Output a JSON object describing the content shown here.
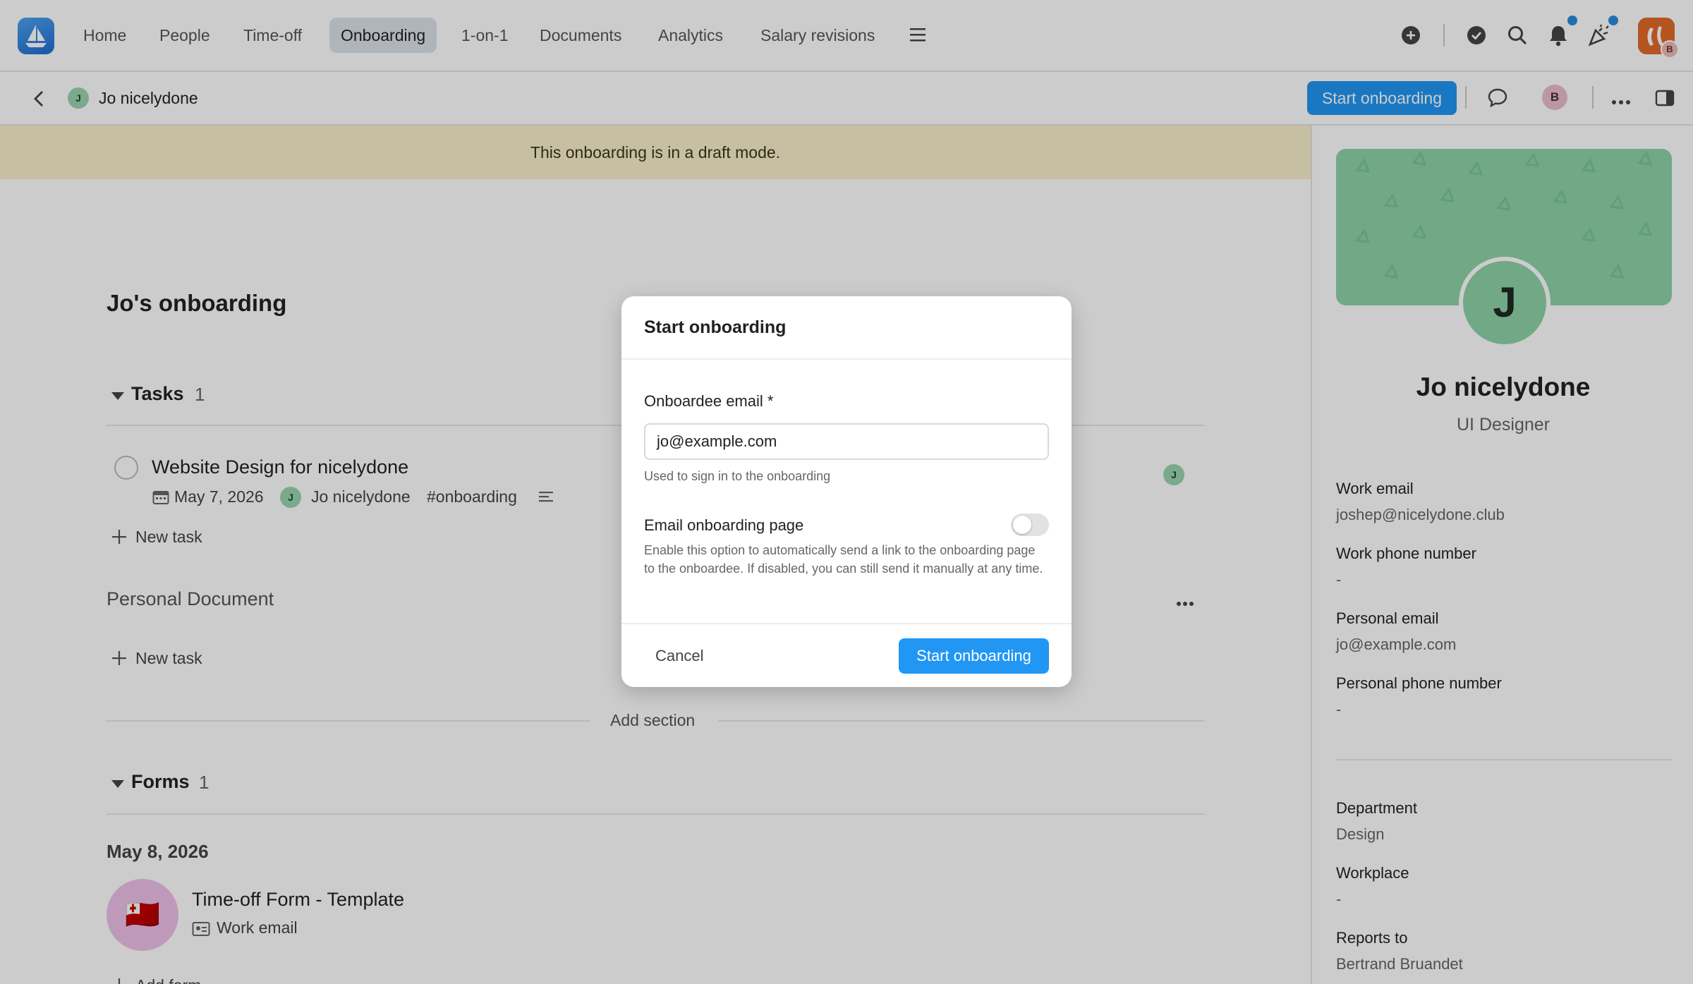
{
  "nav": {
    "items": [
      "Home",
      "People",
      "Time-off",
      "Onboarding",
      "1-on-1",
      "Documents",
      "Analytics",
      "Salary revisions"
    ],
    "active": "Onboarding",
    "brand_initial": "B"
  },
  "subheader": {
    "avatar_initial": "J",
    "name": "Jo nicelydone",
    "start_button": "Start onboarding",
    "user_initial": "B"
  },
  "banner": {
    "text": "This onboarding is in a draft mode."
  },
  "main": {
    "title": "Jo's onboarding",
    "tasks": {
      "label": "Tasks",
      "count": "1",
      "task": {
        "title": "Website Design for nicelydone",
        "date": "May 7, 2026",
        "assignee_initial": "J",
        "assignee": "Jo nicelydone",
        "tag": "#onboarding",
        "right_initial": "J"
      },
      "new_task": "New task"
    },
    "personal_document": {
      "label": "Personal Document",
      "new_task": "New task"
    },
    "add_section": "Add section",
    "forms": {
      "label": "Forms",
      "count": "1",
      "date": "May 8, 2026",
      "form_title": "Time-off Form - Template",
      "form_field": "Work email",
      "flag": "🇹🇴",
      "add_form": "Add form"
    }
  },
  "profile": {
    "initial": "J",
    "name": "Jo nicelydone",
    "role": "UI Designer",
    "fields": [
      {
        "label": "Work email",
        "value": "joshep@nicelydone.club"
      },
      {
        "label": "Work phone number",
        "value": "-"
      },
      {
        "label": "Personal email",
        "value": "jo@example.com"
      },
      {
        "label": "Personal phone number",
        "value": "-"
      },
      {
        "label": "Department",
        "value": "Design"
      },
      {
        "label": "Workplace",
        "value": "-"
      },
      {
        "label": "Reports to",
        "value": "Bertrand Bruandet"
      }
    ]
  },
  "modal": {
    "title": "Start onboarding",
    "email_label": "Onboardee email *",
    "email_value": "jo@example.com",
    "email_hint": "Used to sign in to the onboarding",
    "toggle_label": "Email onboarding page",
    "toggle_on": false,
    "toggle_hint": "Enable this option to automatically send a link to the onboarding page to the onboardee. If disabled, you can still send it manually at any time.",
    "cancel": "Cancel",
    "confirm": "Start onboarding"
  },
  "colors": {
    "primary": "#2196f3",
    "banner": "#f8efcb",
    "avatar_green": "#8ed3a8"
  }
}
